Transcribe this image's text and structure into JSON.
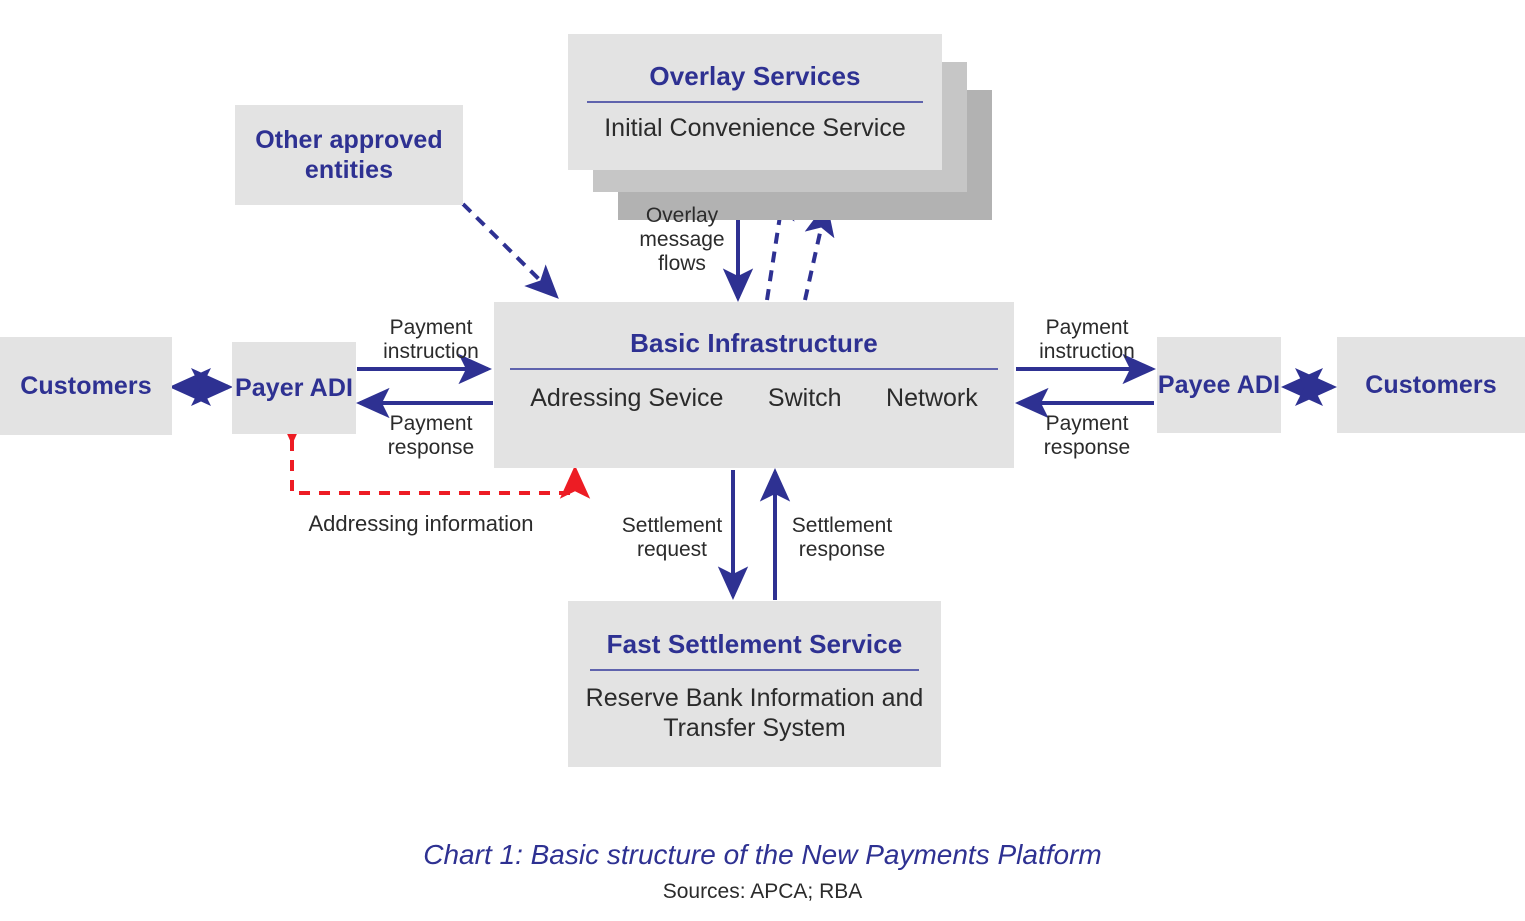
{
  "caption": {
    "title": "Chart 1: Basic structure of the New Payments Platform",
    "sources": "Sources: APCA; RBA"
  },
  "colors": {
    "brand_navy": "#2e3192",
    "box_fill": "#e3e3e3",
    "shadow_light": "#c6c6c6",
    "shadow_dark": "#b2b2b2",
    "divider": "#5f63ad",
    "arrow_blue": "#2e3192",
    "arrow_red": "#ed1c24",
    "body_text": "#2b2b2b"
  },
  "nodes": {
    "customers_left": {
      "title": "Customers"
    },
    "payer_adi": {
      "title": "Payer\nADI"
    },
    "other_entities": {
      "title": "Other approved\nentities"
    },
    "overlay_services": {
      "title": "Overlay Services",
      "subtitle": "Initial Convenience Service"
    },
    "basic_infrastructure": {
      "title": "Basic Infrastructure",
      "services": [
        {
          "label": "Adressing\nSevice"
        },
        {
          "label": "Switch"
        },
        {
          "label": "Network"
        }
      ]
    },
    "payee_adi": {
      "title": "Payee\nADI"
    },
    "customers_right": {
      "title": "Customers"
    },
    "fast_settlement": {
      "title": "Fast Settlement Service",
      "subtitle": "Reserve Bank Information\nand Transfer System"
    }
  },
  "edges": {
    "payment_instruction_left": "Payment\ninstruction",
    "payment_response_left": "Payment\nresponse",
    "payment_instruction_right": "Payment\ninstruction",
    "payment_response_right": "Payment\nresponse",
    "overlay_message_flows": "Overlay\nmessage\nflows",
    "settlement_request": "Settlement\nrequest",
    "settlement_response": "Settlement\nresponse",
    "addressing_information": "Addressing information"
  },
  "chart_data": {
    "type": "diagram",
    "title": "Chart 1: Basic structure of the New Payments Platform",
    "sources": "Sources: APCA; RBA",
    "nodes": [
      {
        "id": "customers_left",
        "label": "Customers",
        "kind": "actor"
      },
      {
        "id": "payer_adi",
        "label": "Payer ADI",
        "kind": "actor"
      },
      {
        "id": "other_entities",
        "label": "Other approved entities",
        "kind": "actor"
      },
      {
        "id": "overlay_services",
        "label": "Overlay Services",
        "sublabel": "Initial Convenience Service",
        "kind": "stacked-service"
      },
      {
        "id": "basic_infrastructure",
        "label": "Basic Infrastructure",
        "components": [
          "Adressing Sevice",
          "Switch",
          "Network"
        ],
        "kind": "platform"
      },
      {
        "id": "payee_adi",
        "label": "Payee ADI",
        "kind": "actor"
      },
      {
        "id": "customers_right",
        "label": "Customers",
        "kind": "actor"
      },
      {
        "id": "fast_settlement",
        "label": "Fast Settlement Service",
        "sublabel": "Reserve Bank Information and Transfer System",
        "kind": "settlement"
      }
    ],
    "links": [
      {
        "from": "customers_left",
        "to": "payer_adi",
        "label": "",
        "style": "solid",
        "direction": "both",
        "color": "#2e3192"
      },
      {
        "from": "payer_adi",
        "to": "basic_infrastructure",
        "label": "Payment instruction",
        "style": "solid",
        "direction": "forward",
        "color": "#2e3192"
      },
      {
        "from": "basic_infrastructure",
        "to": "payer_adi",
        "label": "Payment response",
        "style": "solid",
        "direction": "forward",
        "color": "#2e3192"
      },
      {
        "from": "basic_infrastructure",
        "to": "payee_adi",
        "label": "Payment instruction",
        "style": "solid",
        "direction": "forward",
        "color": "#2e3192"
      },
      {
        "from": "payee_adi",
        "to": "basic_infrastructure",
        "label": "Payment response",
        "style": "solid",
        "direction": "forward",
        "color": "#2e3192"
      },
      {
        "from": "payee_adi",
        "to": "customers_right",
        "label": "",
        "style": "solid",
        "direction": "both",
        "color": "#2e3192"
      },
      {
        "from": "other_entities",
        "to": "basic_infrastructure",
        "label": "",
        "style": "dashed",
        "direction": "forward",
        "color": "#2e3192"
      },
      {
        "from": "overlay_services",
        "to": "basic_infrastructure",
        "label": "Overlay message flows",
        "style": "solid",
        "direction": "forward",
        "color": "#2e3192"
      },
      {
        "from": "basic_infrastructure",
        "to": "overlay_services",
        "label": "",
        "style": "dashed",
        "direction": "forward",
        "color": "#2e3192",
        "count": 2
      },
      {
        "from": "basic_infrastructure",
        "to": "fast_settlement",
        "label": "Settlement request",
        "style": "solid",
        "direction": "forward",
        "color": "#2e3192"
      },
      {
        "from": "fast_settlement",
        "to": "basic_infrastructure",
        "label": "Settlement response",
        "style": "solid",
        "direction": "forward",
        "color": "#2e3192"
      },
      {
        "from": "basic_infrastructure",
        "to": "payer_adi",
        "label": "Addressing information",
        "style": "dashed",
        "direction": "both",
        "color": "#ed1c24"
      }
    ]
  }
}
